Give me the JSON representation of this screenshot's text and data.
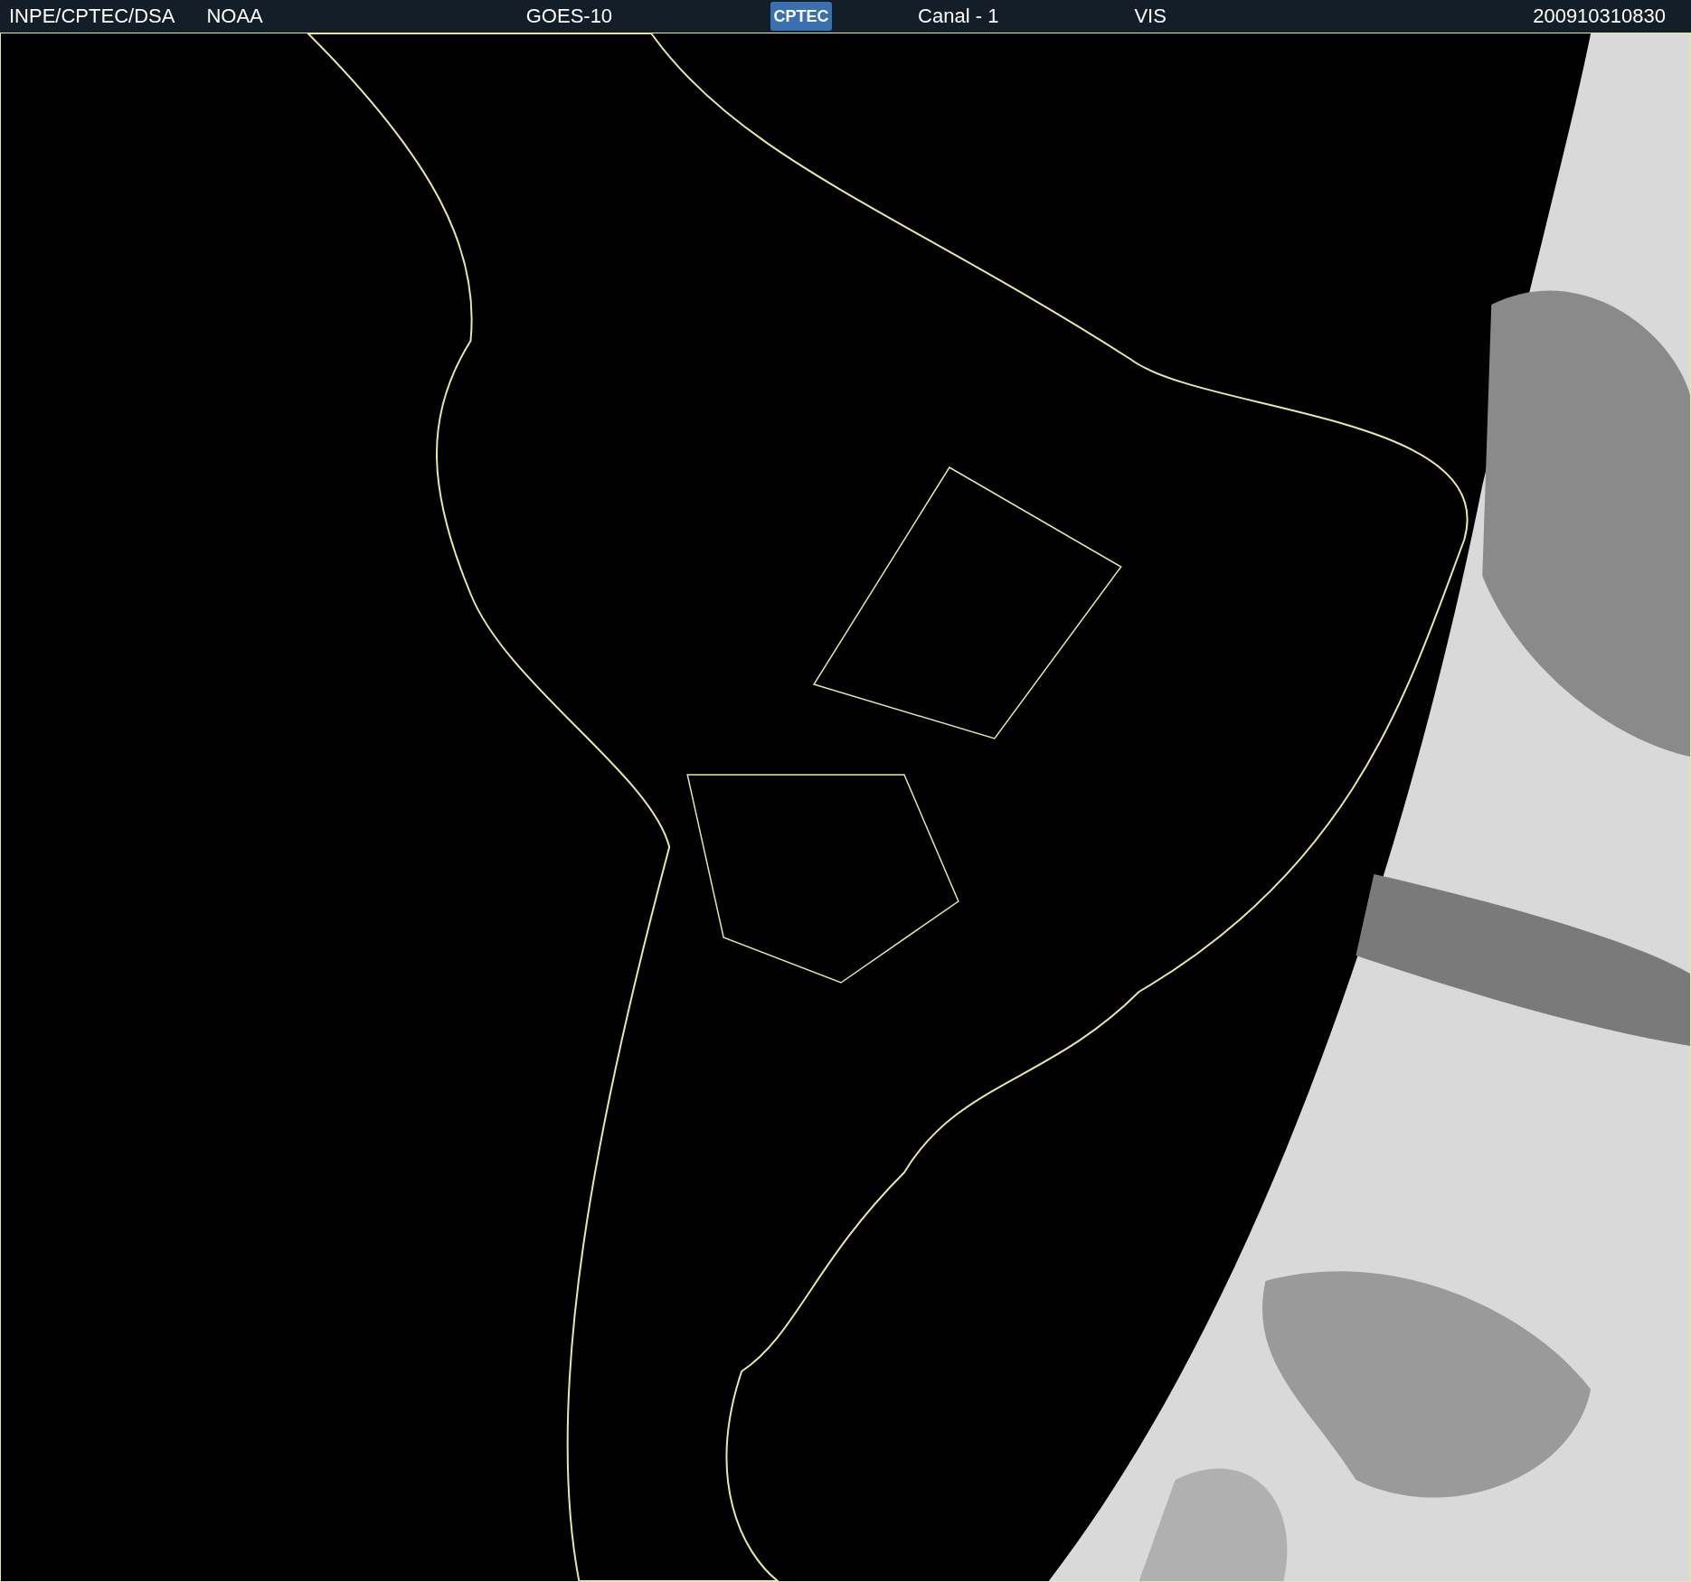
{
  "header": {
    "source": "INPE/CPTEC/DSA",
    "agency": "NOAA",
    "satellite": "GOES-10",
    "logo": "CPTEC",
    "channel": "Canal - 1",
    "band": "VIS",
    "timestamp": "200910310830"
  }
}
